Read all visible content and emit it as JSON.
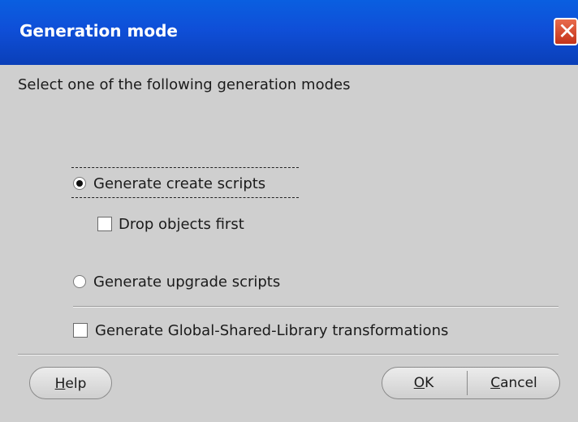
{
  "dialog": {
    "title": "Generation mode",
    "instruction": "Select one of the following generation modes",
    "options": {
      "create": "Generate create scripts",
      "drop_first": "Drop objects first",
      "upgrade": "Generate upgrade scripts",
      "global_shared": "Generate Global-Shared-Library transformations"
    },
    "selected_mode": "create",
    "drop_first_checked": false,
    "global_shared_checked": false
  },
  "buttons": {
    "help_m": "H",
    "help_rest": "elp",
    "ok_m": "O",
    "ok_rest": "K",
    "cancel_m": "C",
    "cancel_rest": "ancel"
  },
  "colors": {
    "titlebar": "#0f4fd8",
    "dialog_bg": "#cfcfcf",
    "close_button": "#d4472b"
  },
  "icons": {
    "close": "close-icon"
  }
}
